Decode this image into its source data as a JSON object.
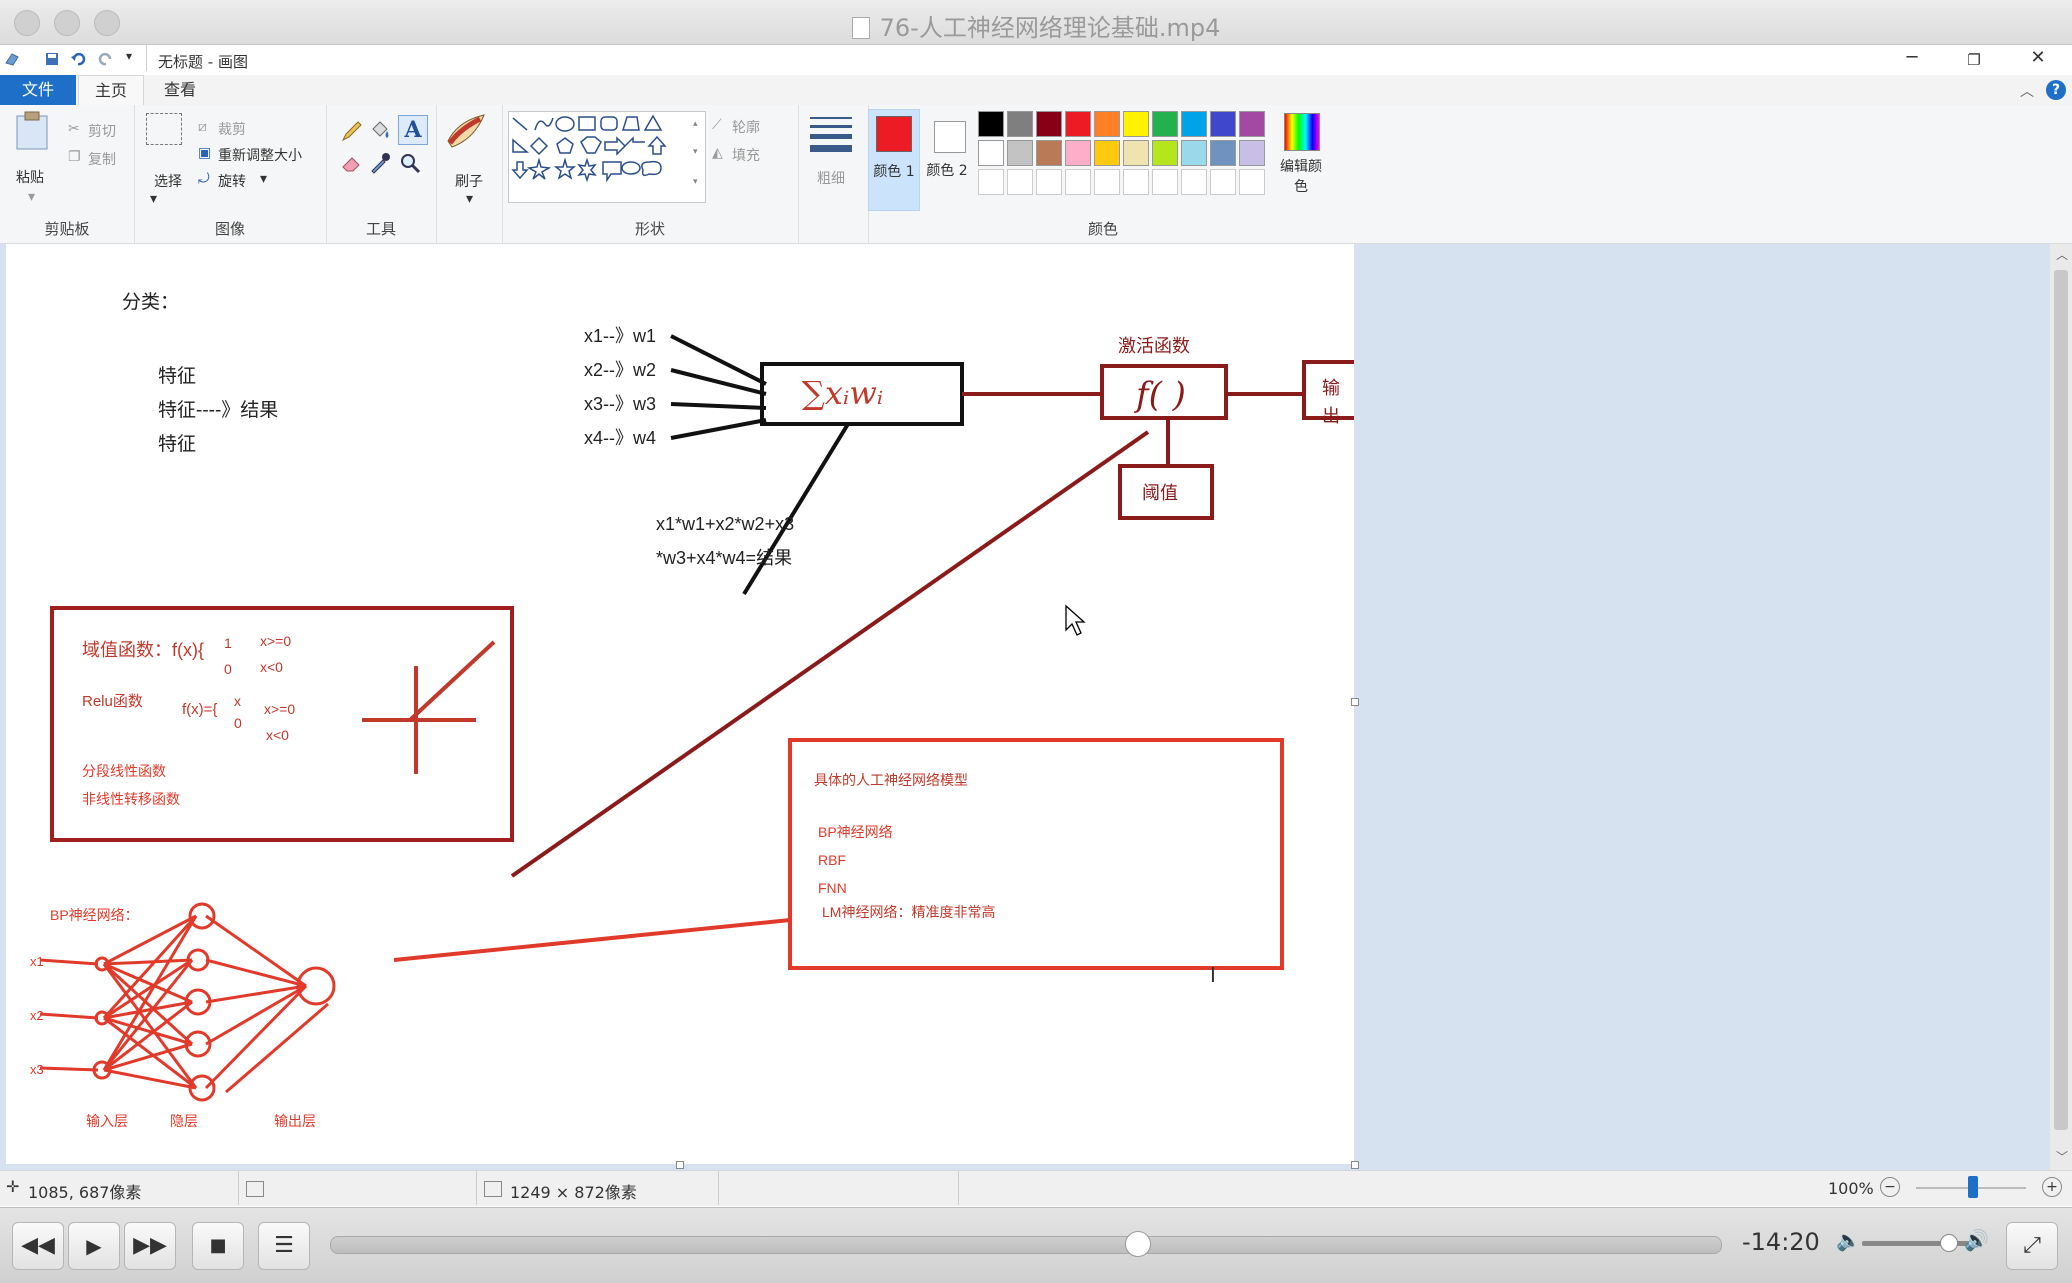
{
  "window": {
    "title": "76-人工神经网络理论基础.mp4"
  },
  "paint": {
    "quick_title": "无标题 - 画图",
    "tabs": [
      "文件",
      "主页",
      "查看"
    ],
    "ribbon": {
      "clipboard": {
        "paste": "粘贴",
        "cut": "剪切",
        "copy": "复制",
        "label": "剪贴板"
      },
      "image": {
        "select": "选择",
        "crop": "裁剪",
        "resize": "重新调整大小",
        "rotate": "旋转",
        "label": "图像"
      },
      "tools": {
        "label": "工具"
      },
      "brushes": {
        "label": "刷子"
      },
      "shapes": {
        "outline": "轮廓",
        "fill": "填充",
        "label": "形状"
      },
      "size": {
        "label": "粗细"
      },
      "color1": "颜色 1",
      "color2": "颜色 2",
      "edit_colors": "编辑颜色",
      "colors_label": "颜色"
    },
    "palette_row1": [
      "#000000",
      "#7f7f7f",
      "#880015",
      "#ed1c24",
      "#ff7f27",
      "#fff200",
      "#22b14c",
      "#00a2e8",
      "#3f48cc",
      "#a349a4"
    ],
    "palette_row2": [
      "#ffffff",
      "#c3c3c3",
      "#b97a57",
      "#ffaec9",
      "#ffc90e",
      "#efe4b0",
      "#b5e61d",
      "#99d9ea",
      "#7092be",
      "#c8bfe7"
    ],
    "color1_value": "#ed1c24",
    "color2_value": "#ffffff"
  },
  "drawing": {
    "classify_title": "分类：",
    "features": [
      "特征",
      "特征----》结果",
      "特征"
    ],
    "inputs": [
      "x1--》w1",
      "x2--》w2",
      "x3--》w3",
      "x4--》w4"
    ],
    "sum_symbol": "∑xᵢwᵢ",
    "activation_title": "激活函数",
    "activation_symbol": "f( )",
    "output_label": "输出",
    "threshold_label": "阈值",
    "formula_line1": "x1*w1+x2*w2+x3",
    "formula_line2": "*w3+x4*w4=结果",
    "fn_box": {
      "threshold_fn": "域值函数：f(x){",
      "threshold_cases": [
        "1",
        "0"
      ],
      "threshold_conds": [
        "x>=0",
        "x<0"
      ],
      "relu": "Relu函数",
      "relu_fx": "f(x)={",
      "relu_cases": [
        "x",
        "0"
      ],
      "relu_conds": [
        "x>=0",
        "x<0"
      ],
      "piecewise": "分段线性函数",
      "nonlinear": "非线性转移函数"
    },
    "models_box": {
      "title": "具体的人工神经网络模型",
      "items": [
        "BP神经网络",
        "RBF",
        "FNN",
        "LM神经网络：精准度非常高"
      ]
    },
    "bp": {
      "title": "BP神经网络：",
      "inputs": [
        "x1",
        "x2",
        "x3"
      ],
      "layers": [
        "输入层",
        "隐层",
        "输出层"
      ]
    }
  },
  "status": {
    "cursor_pos": "1085, 687像素",
    "canvas_size": "1249 × 872像素",
    "zoom": "100%"
  },
  "player": {
    "time_remaining": "-14:20",
    "progress": 0.58
  }
}
